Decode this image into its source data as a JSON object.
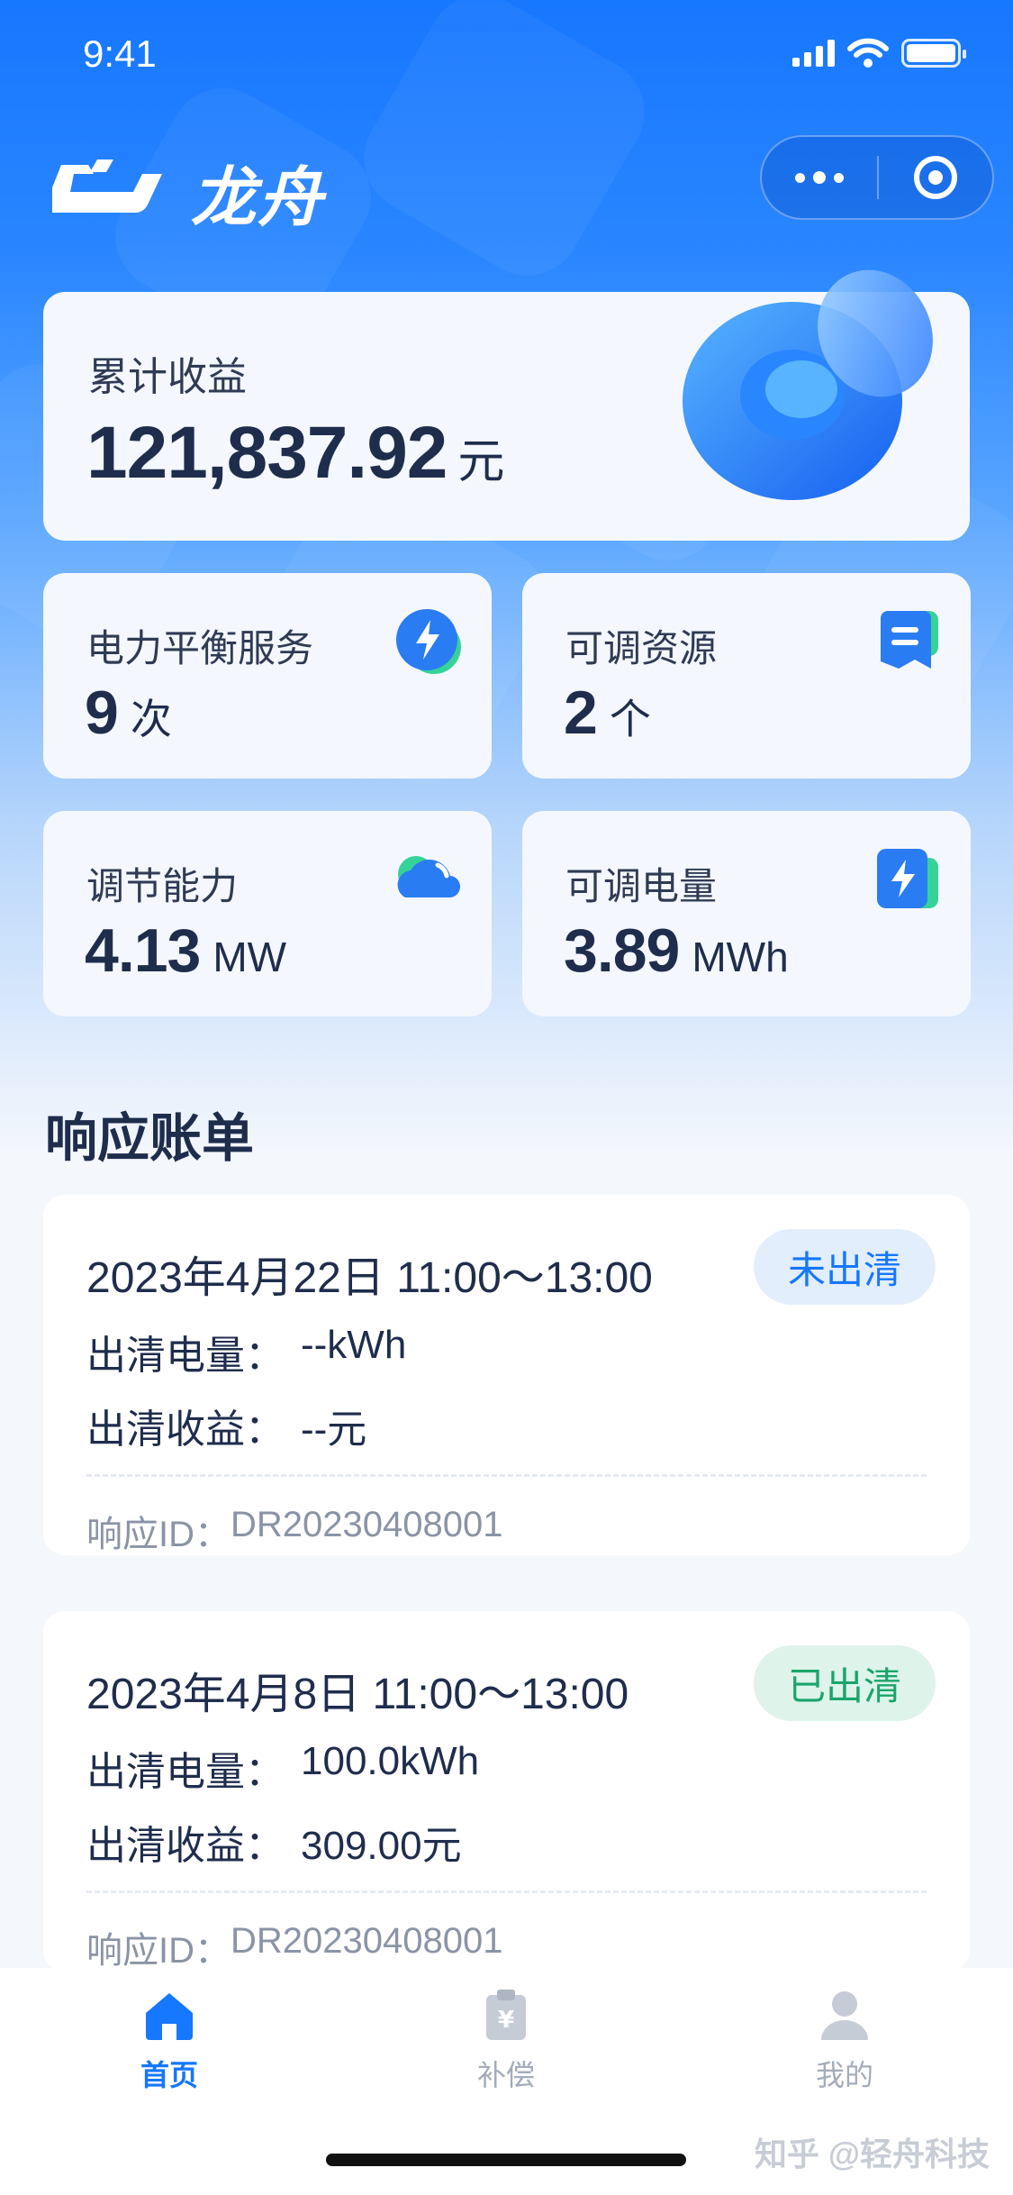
{
  "status_bar": {
    "time": "9:41"
  },
  "header": {
    "app_name": "龙舟"
  },
  "earnings": {
    "title": "累计收益",
    "value": "121,837.92",
    "unit": "元"
  },
  "stats": [
    {
      "title": "电力平衡服务",
      "value": "9",
      "unit": "次",
      "icon": "lightning-circle-icon"
    },
    {
      "title": "可调资源",
      "value": "2",
      "unit": "个",
      "icon": "list-doc-icon"
    },
    {
      "title": "调节能力",
      "value": "4.13",
      "unit": "MW",
      "icon": "cloud-icon"
    },
    {
      "title": "可调电量",
      "value": "3.89",
      "unit": "MWh",
      "icon": "lightning-square-icon"
    }
  ],
  "section": {
    "title": "响应账单"
  },
  "bills": [
    {
      "date": "2023年4月22日 11:00～13:00",
      "status": "未出清",
      "energy_label": "出清电量：",
      "energy_value": "--kWh",
      "income_label": "出清收益：",
      "income_value": "--元",
      "id_label": "响应ID：",
      "id_value": "DR20230408001"
    },
    {
      "date": "2023年4月8日 11:00～13:00",
      "status": "已出清",
      "energy_label": "出清电量：",
      "energy_value": "100.0kWh",
      "income_label": "出清收益：",
      "income_value": "309.00元",
      "id_label": "响应ID：",
      "id_value": "DR20230408001"
    }
  ],
  "tabs": [
    {
      "label": "首页",
      "icon": "home-icon",
      "active": true
    },
    {
      "label": "补偿",
      "icon": "yen-clipboard-icon",
      "active": false
    },
    {
      "label": "我的",
      "icon": "user-icon",
      "active": false
    }
  ],
  "watermark": "知乎 @轻舟科技",
  "colors": {
    "primary": "#1677ff",
    "success": "#19a56a",
    "text": "#1f2d4d",
    "muted": "#8a94a6"
  }
}
